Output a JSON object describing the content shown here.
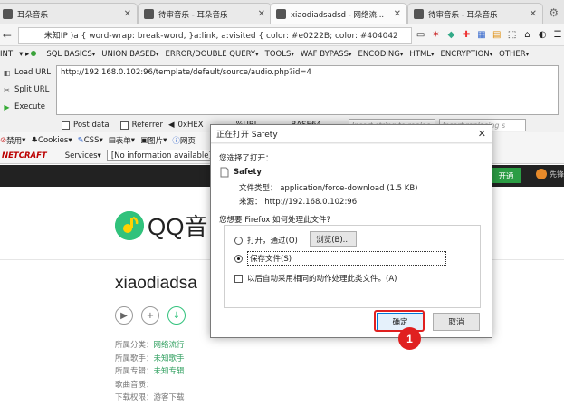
{
  "tabs": [
    {
      "label": "耳朵音乐",
      "active": false
    },
    {
      "label": "待审音乐 - 耳朵音乐",
      "active": false
    },
    {
      "label": "xiaodiadsadsd - 网络流...",
      "active": true
    },
    {
      "label": "待审音乐 - 耳朵音乐",
      "active": false
    }
  ],
  "address": {
    "url_text": "未知IP   )a { word-wrap: break-word, }a:link, a:visited { color: #e0222B; color: #404042"
  },
  "hackbar": {
    "menu": [
      "INT",
      "SQL BASICS",
      "UNION BASED",
      "ERROR/DOUBLE QUERY",
      "TOOLS",
      "WAF BYPASS",
      "ENCODING",
      "HTML",
      "ENCRYPTION",
      "OTHER"
    ],
    "load_url": "Load URL",
    "split_url": "Split URL",
    "execute": "Execute",
    "url_value": "http://192.168.0.102:96/template/default/source/audio.php?id=4",
    "post_data": "Post data",
    "referrer": "Referrer",
    "hex": "0xHEX",
    "url_enc": "%URL",
    "base64": "BASE64",
    "insert_string_placeholder": "Insert string to replac",
    "insert_replacing_placeholder": "Insert replacing s"
  },
  "bookmarks": {
    "row1": [
      "禁用",
      "Cookies",
      "CSS",
      "表单",
      "图片",
      "网页"
    ],
    "netcraft": "NETCRAFT",
    "services": "Services",
    "info": "[No information available]"
  },
  "site": {
    "open_button": "开通",
    "user_label": "先锋",
    "logo_text": "QQ音",
    "song_title": "xiaodiadsa",
    "meta": [
      {
        "label": "所属分类：",
        "value": "网络流行"
      },
      {
        "label": "所属歌手：",
        "value": "未知歌手"
      },
      {
        "label": "所属专辑：",
        "value": "未知专辑"
      },
      {
        "label": "歌曲音质：",
        "value": ""
      },
      {
        "label": "下载权限：",
        "value": "游客下载"
      }
    ]
  },
  "dialog": {
    "title": "正在打开 Safety",
    "opening_label": "您选择了打开：",
    "filename": "Safety",
    "type_label": "文件类型：",
    "type_value": "application/force-download (1.5 KB)",
    "source_label": "来源：",
    "source_value": "http://192.168.0.102:96",
    "question": "您想要 Firefox 如何处理此文件?",
    "open_with": "打开，通过(O)",
    "browse": "浏览(B)...",
    "save_file": "保存文件(S)",
    "auto_check": "以后自动采用相同的动作处理此类文件。(A)",
    "ok": "确定",
    "cancel": "取消"
  },
  "annotation": {
    "marker": "1"
  },
  "colors": {
    "accent_green": "#31c27c",
    "marker_red": "#e02020",
    "dark_bar": "#222222"
  }
}
